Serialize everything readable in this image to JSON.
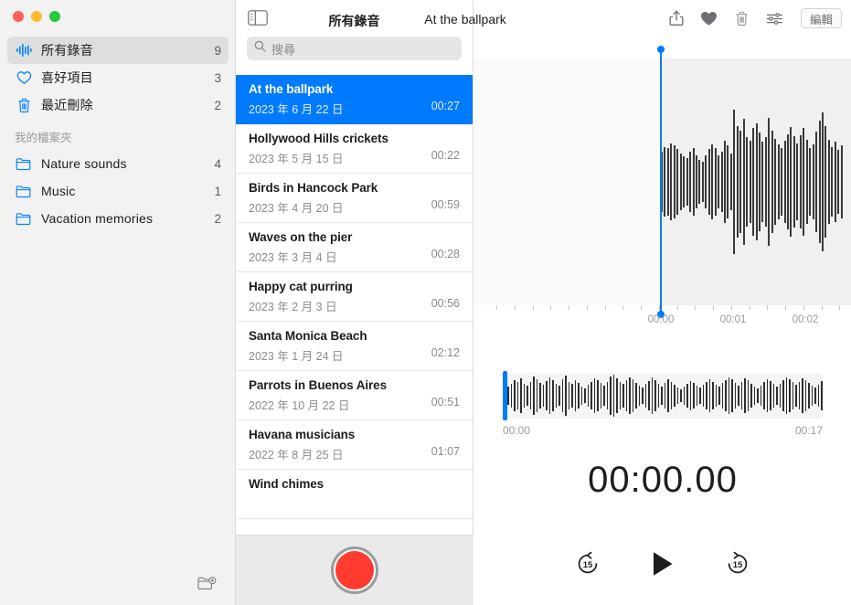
{
  "window": {
    "traffic_lights": [
      "close",
      "minimize",
      "zoom"
    ]
  },
  "sidebar": {
    "items": [
      {
        "label": "所有錄音",
        "count": "9",
        "icon": "waveform-icon",
        "selected": true
      },
      {
        "label": "喜好項目",
        "count": "3",
        "icon": "heart-outline-icon",
        "selected": false
      },
      {
        "label": "最近刪除",
        "count": "2",
        "icon": "trash-icon",
        "selected": false
      }
    ],
    "section_title": "我的檔案夾",
    "folders": [
      {
        "label": "Nature sounds",
        "count": "4",
        "icon": "folder-icon"
      },
      {
        "label": "Music",
        "count": "1",
        "icon": "folder-icon"
      },
      {
        "label": "Vacation memories",
        "count": "2",
        "icon": "folder-icon"
      }
    ],
    "new_folder_icon": "new-folder-icon"
  },
  "list": {
    "title": "所有錄音",
    "search": {
      "placeholder": "搜尋",
      "value": "",
      "icon": "search-icon"
    },
    "recordings": [
      {
        "name": "At the ballpark",
        "date": "2023 年 6 月 22 日",
        "duration": "00:27",
        "selected": true
      },
      {
        "name": "Hollywood Hills crickets",
        "date": "2023 年 5 月 15 日",
        "duration": "00:22",
        "selected": false
      },
      {
        "name": "Birds in Hancock Park",
        "date": "2023 年 4 月 20 日",
        "duration": "00:59",
        "selected": false
      },
      {
        "name": "Waves on the pier",
        "date": "2023 年 3 月 4 日",
        "duration": "00:28",
        "selected": false
      },
      {
        "name": "Happy cat purring",
        "date": "2023 年 2 月 3 日",
        "duration": "00:56",
        "selected": false
      },
      {
        "name": "Santa Monica Beach",
        "date": "2023 年 1 月 24 日",
        "duration": "02:12",
        "selected": false
      },
      {
        "name": "Parrots in Buenos Aires",
        "date": "2022 年 10 月 22 日",
        "duration": "00:51",
        "selected": false
      },
      {
        "name": "Havana musicians",
        "date": "2022 年 8 月 25 日",
        "duration": "01:07",
        "selected": false
      },
      {
        "name": "Wind chimes",
        "date": "",
        "duration": "",
        "selected": false
      }
    ],
    "record_button": {
      "name": "record-button",
      "color": "#ff3b30"
    }
  },
  "toolbar": {
    "sidebar_toggle_icon": "sidebar-toggle-icon",
    "title": "At the ballpark",
    "share_icon": "share-icon",
    "favorite_icon": "heart-filled-icon",
    "delete_icon": "trash-icon",
    "enhance_icon": "sliders-icon",
    "edit_label": "編輯"
  },
  "player": {
    "timeline_labels": [
      "00:00",
      "00:01",
      "00:02"
    ],
    "playhead_time": "00:00",
    "overview": {
      "start_label": "00:00",
      "end_label": "00:17"
    },
    "timer": "00:00.00",
    "controls": {
      "skip_back_label": "15",
      "skip_back_icon": "skip-back-15-icon",
      "play_icon": "play-icon",
      "skip_forward_label": "15",
      "skip_forward_icon": "skip-forward-15-icon"
    }
  },
  "colors": {
    "accent": "#007aff",
    "record": "#ff3b30",
    "selection": "#007aff",
    "sidebar_bg": "#f2f2f2"
  },
  "chart_data": {
    "type": "area",
    "title": "Audio waveform — At the ballpark",
    "detail_waveform": [
      52,
      60,
      58,
      66,
      62,
      56,
      48,
      44,
      40,
      52,
      58,
      46,
      38,
      34,
      46,
      56,
      64,
      58,
      46,
      52,
      70,
      62,
      48,
      124,
      96,
      88,
      108,
      76,
      70,
      92,
      100,
      84,
      68,
      76,
      110,
      88,
      74,
      64,
      58,
      70,
      82,
      94,
      78,
      66,
      80,
      92,
      72,
      58,
      64,
      86,
      104,
      118,
      96,
      72,
      60,
      68,
      54,
      62
    ],
    "overview_waveform": [
      20,
      26,
      34,
      30,
      38,
      26,
      22,
      30,
      42,
      36,
      28,
      24,
      32,
      40,
      34,
      26,
      22,
      36,
      44,
      30,
      26,
      34,
      28,
      20,
      16,
      24,
      30,
      38,
      34,
      28,
      22,
      30,
      42,
      46,
      38,
      30,
      26,
      34,
      40,
      36,
      28,
      22,
      18,
      26,
      32,
      40,
      34,
      26,
      20,
      28,
      36,
      30,
      24,
      18,
      14,
      20,
      26,
      32,
      28,
      22,
      18,
      24,
      30,
      36,
      30,
      24,
      20,
      28,
      34,
      40,
      36,
      28,
      22,
      30,
      38,
      34,
      26,
      20,
      16,
      22,
      30,
      36,
      32,
      26,
      20,
      26,
      34,
      40,
      36,
      30,
      24,
      30,
      38,
      34,
      28,
      22,
      18,
      24,
      32,
      38
    ],
    "xlabel": "",
    "ylabel": "",
    "grid": false
  }
}
